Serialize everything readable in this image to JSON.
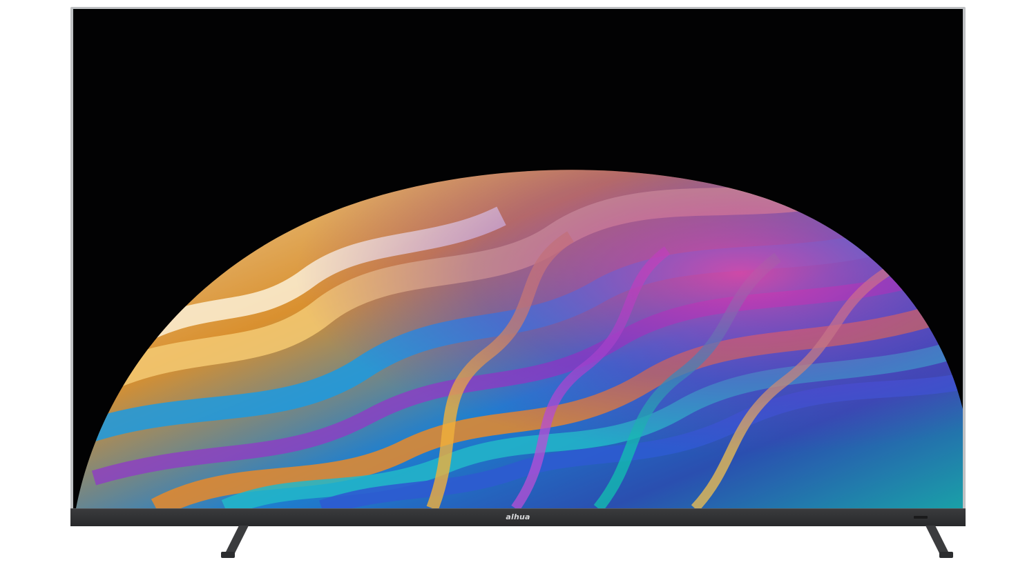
{
  "product": {
    "brand_logo": "alhua",
    "screen_image": "iridescent-soap-bubble-wallpaper"
  },
  "colors": {
    "screen_background": "#020203",
    "bezel": "#bfc1c3",
    "chin": "#2f3032",
    "stand": "#3b3c3e",
    "bubble_gold": "#e9a84a",
    "bubble_blue": "#1f8fd6",
    "bubble_purple": "#6b2fa6",
    "bubble_cream": "#f3e3c4"
  }
}
